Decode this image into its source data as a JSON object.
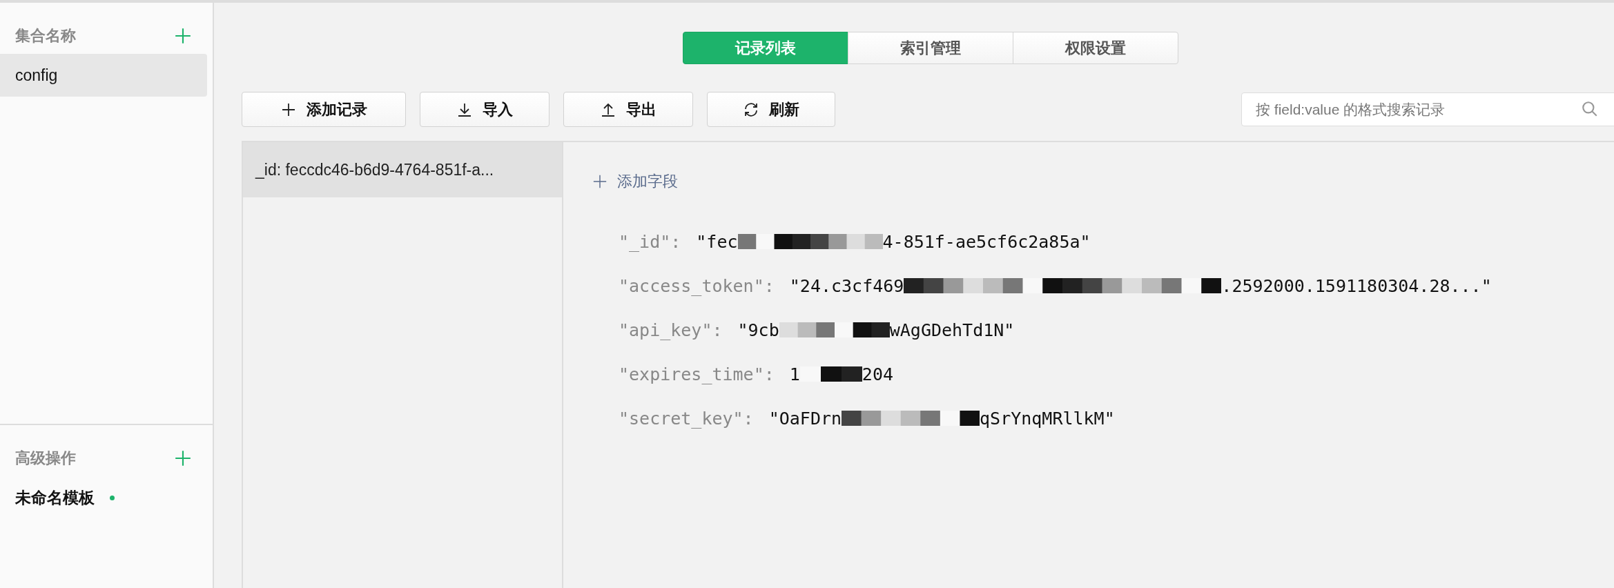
{
  "sidebar": {
    "collections_header": "集合名称",
    "collections": [
      {
        "label": "config",
        "selected": true
      }
    ],
    "advanced_header": "高级操作",
    "templates": [
      {
        "label": "未命名模板",
        "unsaved": true
      }
    ]
  },
  "tabs": [
    {
      "label": "记录列表",
      "selected": true
    },
    {
      "label": "索引管理",
      "selected": false
    },
    {
      "label": "权限设置",
      "selected": false
    }
  ],
  "toolbar": [
    {
      "label": "添加记录",
      "kind": "add"
    },
    {
      "label": "导入",
      "kind": "import"
    },
    {
      "label": "导出",
      "kind": "export"
    },
    {
      "label": "刷新",
      "kind": "refresh"
    }
  ],
  "search": {
    "placeholder": "按 field:value 的格式搜索记录"
  },
  "records": [
    {
      "label": "_id: feccdc46-b6d9-4764-851f-a...",
      "selected": true
    }
  ],
  "add_field": "添加字段",
  "fields": [
    {
      "key": "\"_id\":",
      "value_start": "\"fec",
      "value_end": "4-851f-ae5cf6c2a85a\"",
      "redacted": true
    },
    {
      "key": "\"access_token\":",
      "value_start": "\"24.c3cf469",
      "value_end": ".2592000.1591180304.28...\"",
      "redacted": true
    },
    {
      "key": "\"api_key\":",
      "value_start": "\"9cb",
      "value_end": "wAgGDehTd1N\"",
      "redacted": true
    },
    {
      "key": "\"expires_time\":",
      "value_start": "1",
      "value_end": "204",
      "redacted": true
    },
    {
      "key": "\"secret_key\":",
      "value_start": "\"OaFDrn",
      "value_end": "qSrYnqMRllkM\"",
      "redacted": true
    }
  ]
}
